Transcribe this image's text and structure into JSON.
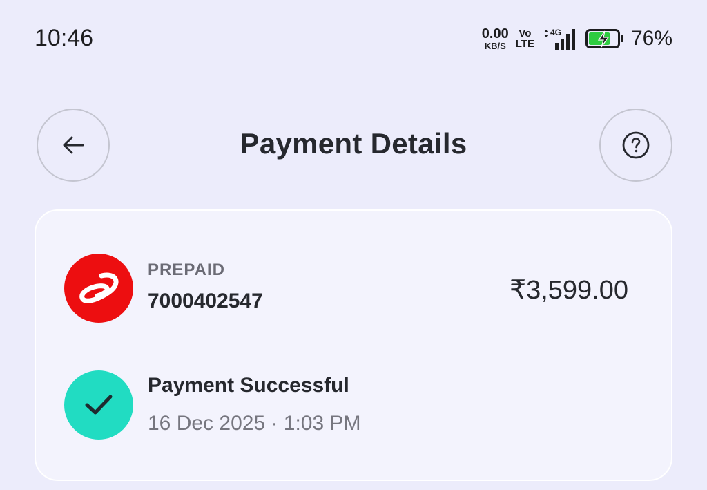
{
  "status_bar": {
    "time": "10:46",
    "net_speed_value": "0.00",
    "net_speed_unit": "KB/S",
    "volte_top": "Vo",
    "volte_bottom": "LTE",
    "network_type": "4G",
    "battery_percent": "76%",
    "battery_level": 0.76,
    "icons": [
      "signal-icon",
      "battery-charging-icon"
    ]
  },
  "header": {
    "title": "Payment Details",
    "back_icon": "arrow-left-icon",
    "help_icon": "question-circle-icon"
  },
  "payment": {
    "plan_label": "PREPAID",
    "phone_number": "7000402547",
    "amount": "₹3,599.00",
    "operator_logo": "airtel-logo",
    "status": "Payment Successful",
    "status_icon": "checkmark-icon",
    "date_time": "16 Dec 2025 · 1:03 PM"
  },
  "colors": {
    "background": "#ececfb",
    "card": "#f3f3fd",
    "operator_red": "#ed0e10",
    "success_teal": "#21dcc2",
    "battery_green": "#2ecc40"
  }
}
